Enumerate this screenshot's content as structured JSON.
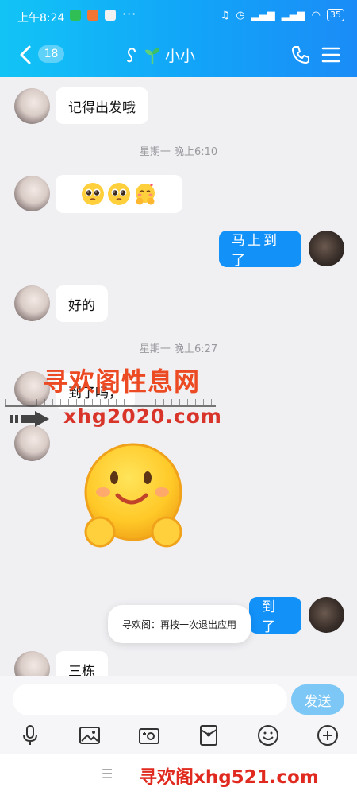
{
  "status_bar": {
    "time": "上午8:24",
    "more": "···",
    "battery": "35"
  },
  "header": {
    "unread_count": "18",
    "title": "小小",
    "back_icon": "chevron-left-icon",
    "call_icon": "phone-icon",
    "menu_icon": "menu-icon"
  },
  "messages": [
    {
      "side": "in",
      "text": "记得出发哦"
    },
    {
      "divider": "星期一  晚上6:10"
    },
    {
      "side": "in",
      "type": "emoji",
      "icons": [
        "pleading-face-icon",
        "pleading-face-icon",
        "hugging-face-icon"
      ]
    },
    {
      "side": "out",
      "text": "马上到了"
    },
    {
      "side": "in",
      "text": "好的"
    },
    {
      "divider": "星期一  晚上6:27"
    },
    {
      "side": "in",
      "text": "到了吗，"
    },
    {
      "side": "in",
      "type": "sticker",
      "icon": "smiling-hug-sticker-icon"
    },
    {
      "side": "out",
      "text": "到了"
    },
    {
      "side": "in",
      "text": "三栋"
    }
  ],
  "watermark": {
    "title": "寻欢阁性息网",
    "domain": "xhg2020.com",
    "footer": "寻欢阁xhg521.com"
  },
  "toast": "寻欢阁：再按一次退出应用",
  "composer": {
    "placeholder": "",
    "send_label": "发送"
  },
  "toolbar": [
    {
      "name": "voice",
      "icon": "microphone-icon"
    },
    {
      "name": "image",
      "icon": "image-icon"
    },
    {
      "name": "camera",
      "icon": "camera-icon"
    },
    {
      "name": "red-packet",
      "icon": "red-packet-icon"
    },
    {
      "name": "emoji",
      "icon": "smiley-icon"
    },
    {
      "name": "more",
      "icon": "plus-circle-icon"
    }
  ],
  "nav": {
    "menu": "☰"
  },
  "colors": {
    "header_start": "#12c4f6",
    "header_end": "#1b8cf7",
    "bubble_out": "#1291f9",
    "send_button": "#7cc7f6",
    "chat_bg": "#f0f0f3"
  }
}
